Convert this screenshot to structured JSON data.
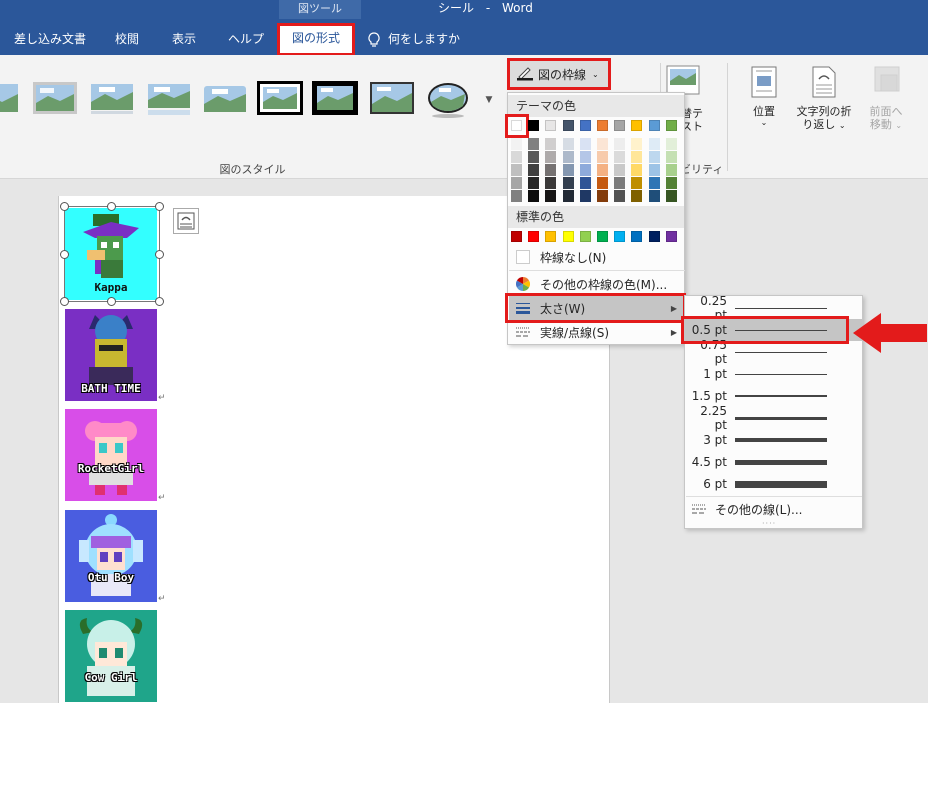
{
  "window": {
    "context_label": "図ツール",
    "doc_name": "シール",
    "separator": "-",
    "app_name": "Word"
  },
  "tabs": [
    {
      "label": "差し込み文書"
    },
    {
      "label": "校閲"
    },
    {
      "label": "表示"
    },
    {
      "label": "ヘルプ"
    },
    {
      "label": "図の形式",
      "active": true
    }
  ],
  "tell_me": "何をしますか",
  "ribbon": {
    "picture_styles_group": "図のスタイル",
    "picture_border_button": "図の枠線",
    "alt_text_label_line1": "替テ",
    "alt_text_label_line2": "スト",
    "accessibility_group_fragment": "ビリティ",
    "position_label": "位置",
    "wrap_text_line1": "文字列の折",
    "wrap_text_line2": "り返し",
    "bring_forward_line1": "前面へ",
    "bring_forward_line2": "移動"
  },
  "border_menu": {
    "theme_colors_header": "テーマの色",
    "standard_colors_header": "標準の色",
    "no_outline": "枠線なし(N)",
    "more_colors": "その他の枠線の色(M)...",
    "weight": "太さ(W)",
    "dashes": "実線/点線(S)",
    "theme_top_row": [
      "#ffffff",
      "#000000",
      "#e7e6e6",
      "#44546a",
      "#4472c4",
      "#ed7d31",
      "#a5a5a5",
      "#ffc000",
      "#5b9bd5",
      "#70ad47"
    ],
    "theme_shades": [
      [
        "#f2f2f2",
        "#d9d9d9",
        "#bfbfbf",
        "#a6a6a6",
        "#808080"
      ],
      [
        "#808080",
        "#595959",
        "#404040",
        "#262626",
        "#0d0d0d"
      ],
      [
        "#d0cece",
        "#aeaaaa",
        "#757171",
        "#3a3838",
        "#171616"
      ],
      [
        "#d6dce4",
        "#adb9ca",
        "#8497b0",
        "#333f4f",
        "#222a35"
      ],
      [
        "#d9e2f3",
        "#b4c6e7",
        "#8eaadb",
        "#2f5496",
        "#1f3864"
      ],
      [
        "#fbe5d5",
        "#f7cbac",
        "#f4b183",
        "#c55a11",
        "#833c0b"
      ],
      [
        "#ededed",
        "#dbdbdb",
        "#c9c9c9",
        "#7b7b7b",
        "#525252"
      ],
      [
        "#fff2cc",
        "#ffe699",
        "#ffd966",
        "#bf8f00",
        "#7f6000"
      ],
      [
        "#deebf6",
        "#bdd7ee",
        "#9dc3e6",
        "#2e75b5",
        "#1f4e79"
      ],
      [
        "#e2efd9",
        "#c5e0b3",
        "#a8d08d",
        "#538135",
        "#375623"
      ]
    ],
    "standard_colors": [
      "#c00000",
      "#ff0000",
      "#ffc000",
      "#ffff00",
      "#92d050",
      "#00b050",
      "#00b0f0",
      "#0070c0",
      "#002060",
      "#7030a0"
    ]
  },
  "weight_menu": {
    "options": [
      {
        "label": "0.25 pt",
        "pt": 0.25
      },
      {
        "label": "0.5 pt",
        "pt": 0.5,
        "selected": true
      },
      {
        "label": "0.75 pt",
        "pt": 0.75
      },
      {
        "label": "1 pt",
        "pt": 1
      },
      {
        "label": "1.5 pt",
        "pt": 1.5
      },
      {
        "label": "2.25 pt",
        "pt": 2.25
      },
      {
        "label": "3 pt",
        "pt": 3
      },
      {
        "label": "4.5 pt",
        "pt": 4.5
      },
      {
        "label": "6 pt",
        "pt": 6
      }
    ],
    "more_lines": "その他の線(L)..."
  },
  "document": {
    "stickers": [
      {
        "caption": "Kappa",
        "bg": "#33ffff"
      },
      {
        "caption": "BATH TIME",
        "bg": "#7a2fc4"
      },
      {
        "caption": "RocketGirl",
        "bg": "#d84ee8"
      },
      {
        "caption": "Otu Boy",
        "bg": "#4a5de0"
      },
      {
        "caption": "Cow Girl",
        "bg": "#1fa58a"
      }
    ]
  },
  "colors": {
    "accent_blue": "#2b579a",
    "highlight_red": "#e31b1b"
  }
}
